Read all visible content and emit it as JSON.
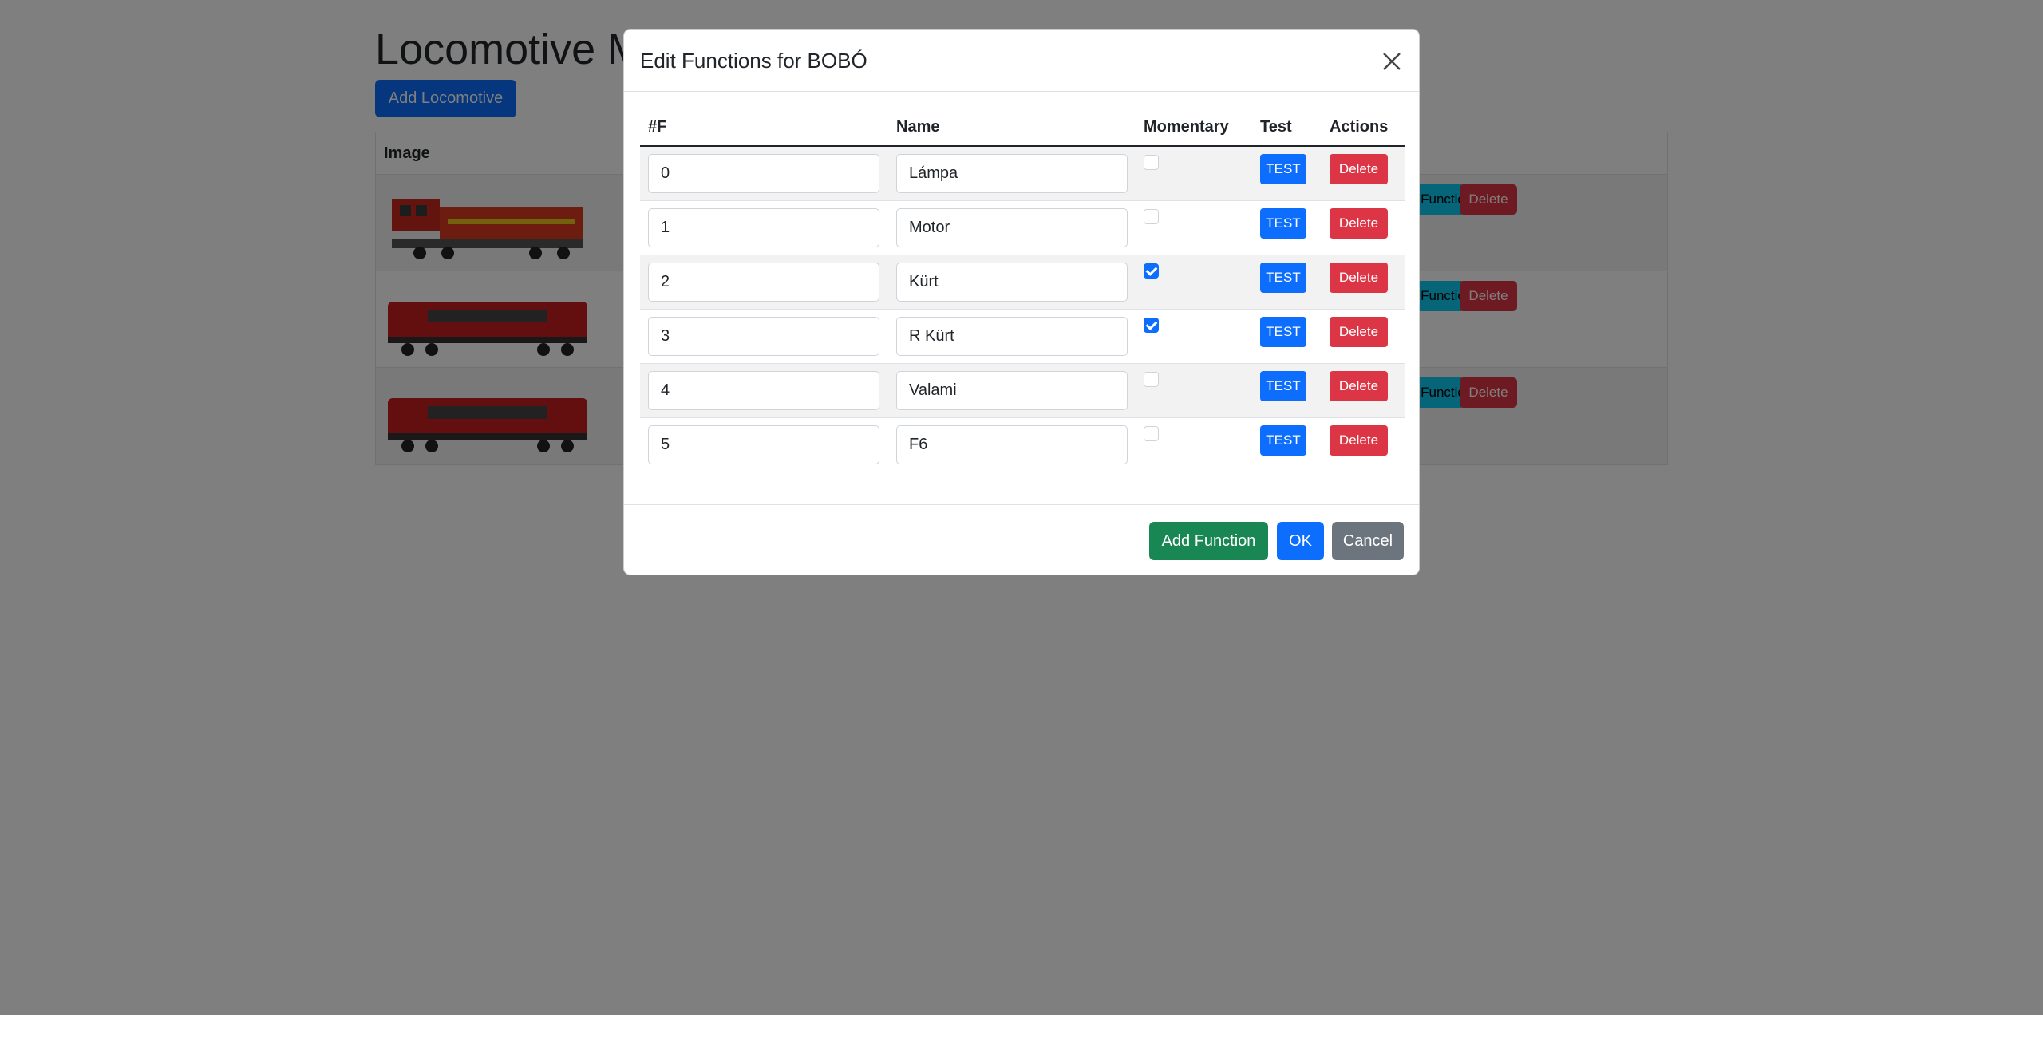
{
  "page": {
    "title": "Locomotive Management",
    "add_locomotive_label": "Add Locomotive",
    "table": {
      "image_header": "Image",
      "rows": [
        {
          "functions_label": "Functions",
          "delete_label": "Delete"
        },
        {
          "functions_label": "Functions",
          "delete_label": "Delete"
        },
        {
          "functions_label": "Functions",
          "delete_label": "Delete"
        }
      ]
    }
  },
  "modal": {
    "title": "Edit Functions for BOBÓ",
    "columns": {
      "f": "#F",
      "name": "Name",
      "momentary": "Momentary",
      "test": "Test",
      "actions": "Actions"
    },
    "functions": [
      {
        "number": "0",
        "name": "Lámpa",
        "momentary": false
      },
      {
        "number": "1",
        "name": "Motor",
        "momentary": false
      },
      {
        "number": "2",
        "name": "Kürt",
        "momentary": true
      },
      {
        "number": "3",
        "name": "R Kürt",
        "momentary": true
      },
      {
        "number": "4",
        "name": "Valami",
        "momentary": false
      },
      {
        "number": "5",
        "name": "F6",
        "momentary": false
      }
    ],
    "test_label": "TEST",
    "delete_label": "Delete",
    "footer": {
      "add_function_label": "Add Function",
      "ok_label": "OK",
      "cancel_label": "Cancel"
    }
  },
  "colors": {
    "primary": "#0d6efd",
    "danger": "#dc3545",
    "success": "#198754",
    "secondary": "#6c757d",
    "info": "#0dcaf0",
    "backdrop": "rgba(0,0,0,0.5)"
  },
  "icons": {
    "close": "close-icon",
    "locomotive": "locomotive-icon"
  }
}
